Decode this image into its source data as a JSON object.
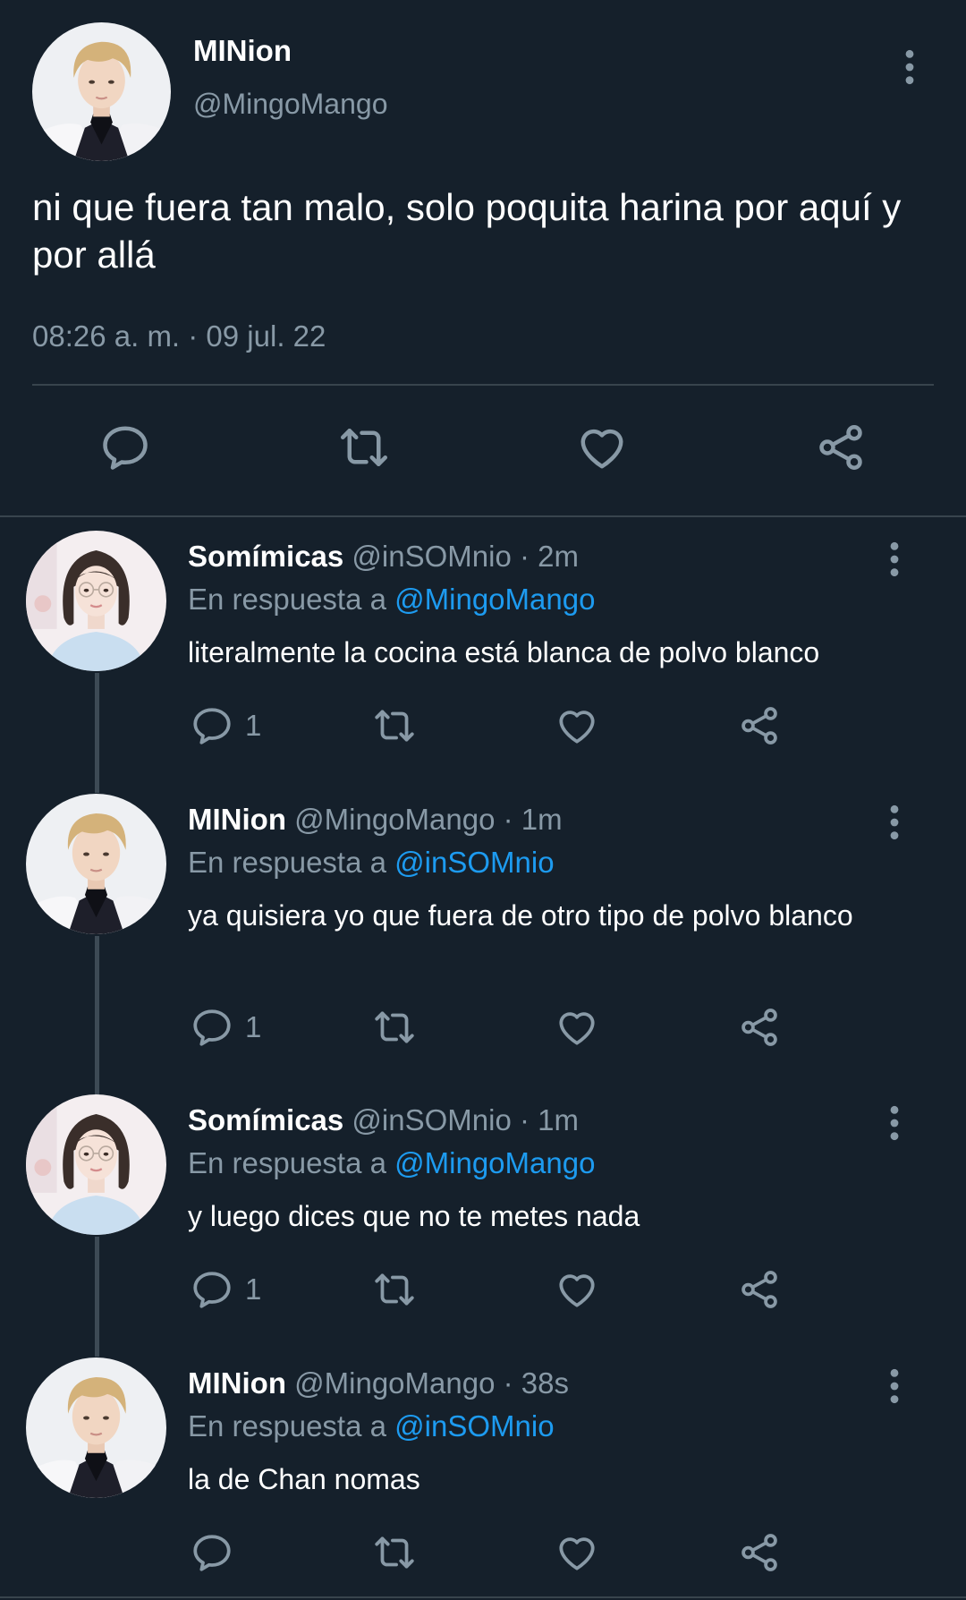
{
  "main_tweet": {
    "name": "MINion",
    "handle": "@MingoMango",
    "text": "ni que fuera tan malo, solo poquita harina por aquí y por allá",
    "timestamp": "08:26 a. m. · 09 jul. 22",
    "actions": [
      "reply-icon",
      "retweet-icon",
      "like-icon",
      "share-icon"
    ]
  },
  "replies": [
    {
      "name": "Somímicas",
      "meta": "@inSOMnio · 2m",
      "reply_prefix": "En respuesta a",
      "reply_to": "@MingoMango",
      "text": "literalmente la cocina está blanca de polvo blanco",
      "reply_count": "1",
      "avatar": "female"
    },
    {
      "name": "MINion",
      "meta": "@MingoMango · 1m",
      "reply_prefix": "En respuesta a",
      "reply_to": "@inSOMnio",
      "text": "ya quisiera yo que fuera de otro tipo de polvo blanco",
      "reply_count": "1",
      "avatar": "male"
    },
    {
      "name": "Somímicas",
      "meta": "@inSOMnio · 1m",
      "reply_prefix": "En respuesta a",
      "reply_to": "@MingoMango",
      "text": "y luego dices que no te metes nada",
      "reply_count": "1",
      "avatar": "female"
    },
    {
      "name": "MINion",
      "meta": "@MingoMango · 38s",
      "reply_prefix": "En respuesta a",
      "reply_to": "@inSOMnio",
      "text": "la de Chan nomas",
      "reply_count": "",
      "avatar": "male"
    }
  ],
  "colors": {
    "background": "#15202b",
    "secondary_text": "#8899a6",
    "mention": "#1d9bf0",
    "divider": "#38444d"
  }
}
